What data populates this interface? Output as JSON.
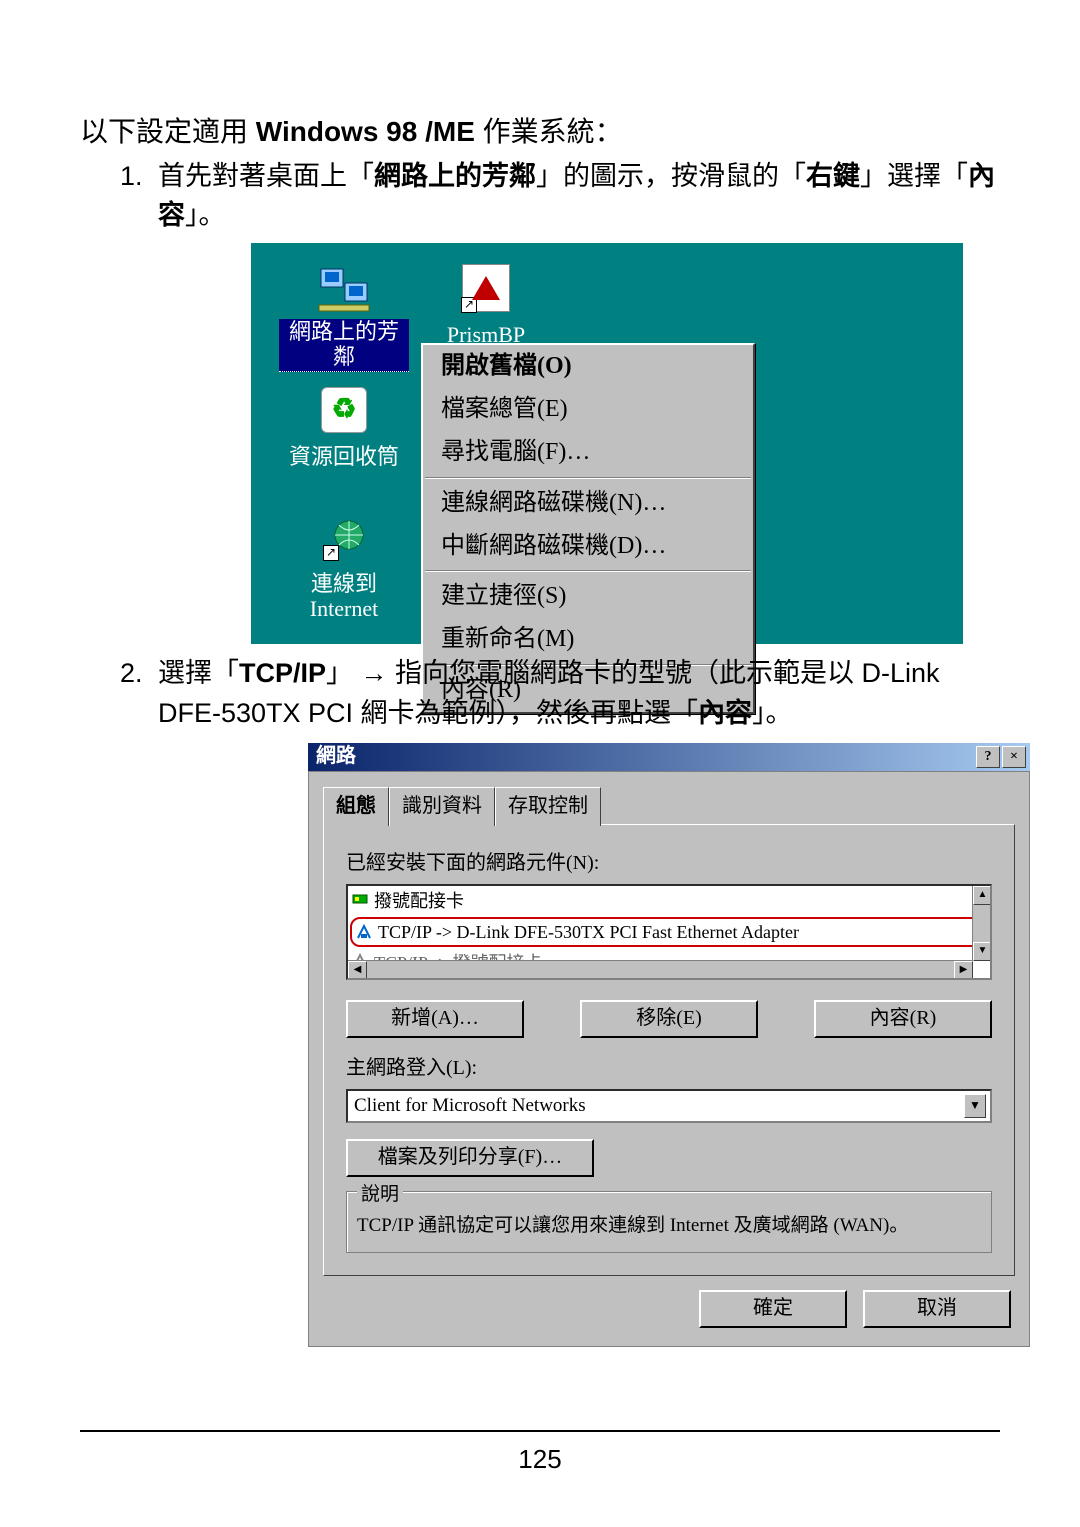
{
  "heading_prefix": "以下設定適用 ",
  "heading_bold": "Windows 98 /ME",
  "heading_suffix": " 作業系統：",
  "step1": {
    "t1": "首先對著桌面上「",
    "b1": "網路上的芳鄰",
    "t2": "」的圖示，按滑鼠的「",
    "b2": "右鍵",
    "t3": "」選擇「",
    "b3": "內容",
    "t4": "」。"
  },
  "desktop": {
    "neighborhood_label": "網路上的芳鄰",
    "prism_label": "PrismBP",
    "recycle_label": "資源回收筒",
    "connect_label_l1": "連線到",
    "connect_label_l2": "Internet"
  },
  "context_menu": {
    "open": "開啟舊檔(O)",
    "explorer": "檔案總管(E)",
    "find": "尋找電腦(F)…",
    "map": "連線網路磁碟機(N)…",
    "unmap": "中斷網路磁碟機(D)…",
    "shortcut": "建立捷徑(S)",
    "rename": "重新命名(M)",
    "properties": "內容(R)"
  },
  "step2": {
    "t1": "選擇「",
    "b1": "TCP/IP",
    "t2": "」 → 指向您電腦網路卡的型號（此示範是以 D-Link DFE-530TX  PCI 網卡為範例），然後再點選「",
    "b2": "內容",
    "t3": "」。"
  },
  "dialog": {
    "title": "網路",
    "tabs": {
      "config": "組態",
      "id": "識別資料",
      "access": "存取控制"
    },
    "installed_label": "已經安裝下面的網路元件(N):",
    "rows": {
      "r1": "撥號配接卡",
      "r2": "TCP/IP -> D-Link DFE-530TX PCI Fast Ethernet Adapter",
      "r3": "TCP/IP -> 撥號配接卡"
    },
    "add_btn": "新增(A)…",
    "remove_btn": "移除(E)",
    "prop_btn": "內容(R)",
    "login_label": "主網路登入(L):",
    "login_value": "Client for Microsoft Networks",
    "share_btn": "檔案及列印分享(F)…",
    "desc_title": "說明",
    "desc_body": "TCP/IP 通訊協定可以讓您用來連線到 Internet 及廣域網路 (WAN)。",
    "ok": "確定",
    "cancel": "取消"
  },
  "page_number": "125"
}
